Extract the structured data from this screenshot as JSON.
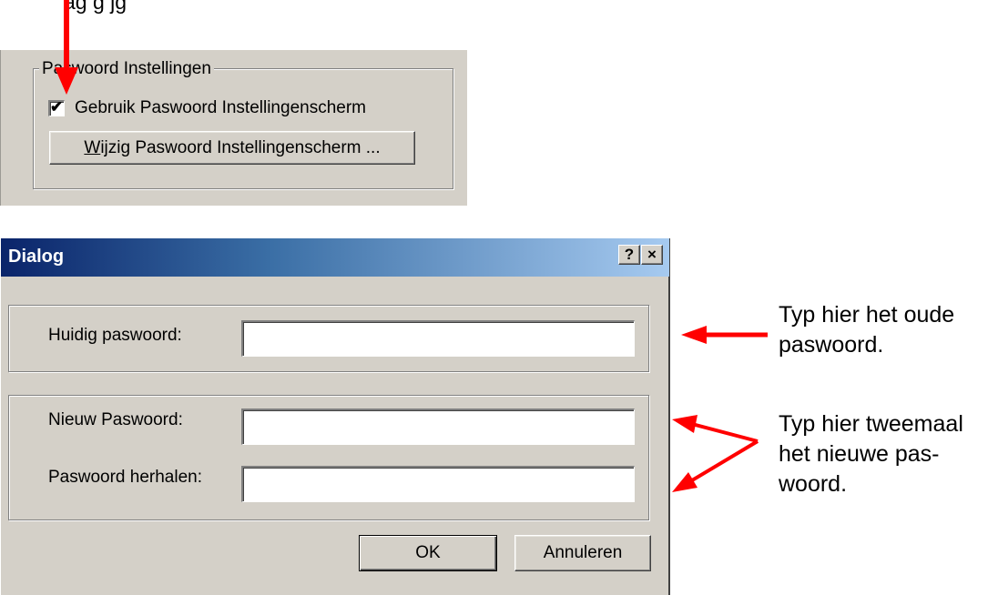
{
  "caption_top": "ag    g   jg",
  "settings": {
    "group_title": "Paswoord Instellingen",
    "checkbox_label": "Gebruik Paswoord Instellingenscherm",
    "checkbox_checked": true,
    "button_mnemonic": "W",
    "button_label_rest": "ijzig Paswoord Instellingenscherm ..."
  },
  "dialog": {
    "title": "Dialog",
    "help_button": "?",
    "close_button": "×",
    "current_password_label": "Huidig paswoord:",
    "new_password_label": "Nieuw Paswoord:",
    "repeat_password_label": "Paswoord herhalen:",
    "current_password_value": "",
    "new_password_value": "",
    "repeat_password_value": "",
    "ok_label": "OK",
    "cancel_label": "Annuleren"
  },
  "annotations": {
    "old_password": [
      "Typ hier het oude",
      "paswoord."
    ],
    "new_password": [
      "Typ hier tweemaal",
      "het nieuwe pas-",
      "woord."
    ]
  },
  "colors": {
    "arrow": "#ff0000",
    "dialog_face": "#d4d0c8",
    "titlebar_start": "#0a246a",
    "titlebar_end": "#a6caf0"
  }
}
